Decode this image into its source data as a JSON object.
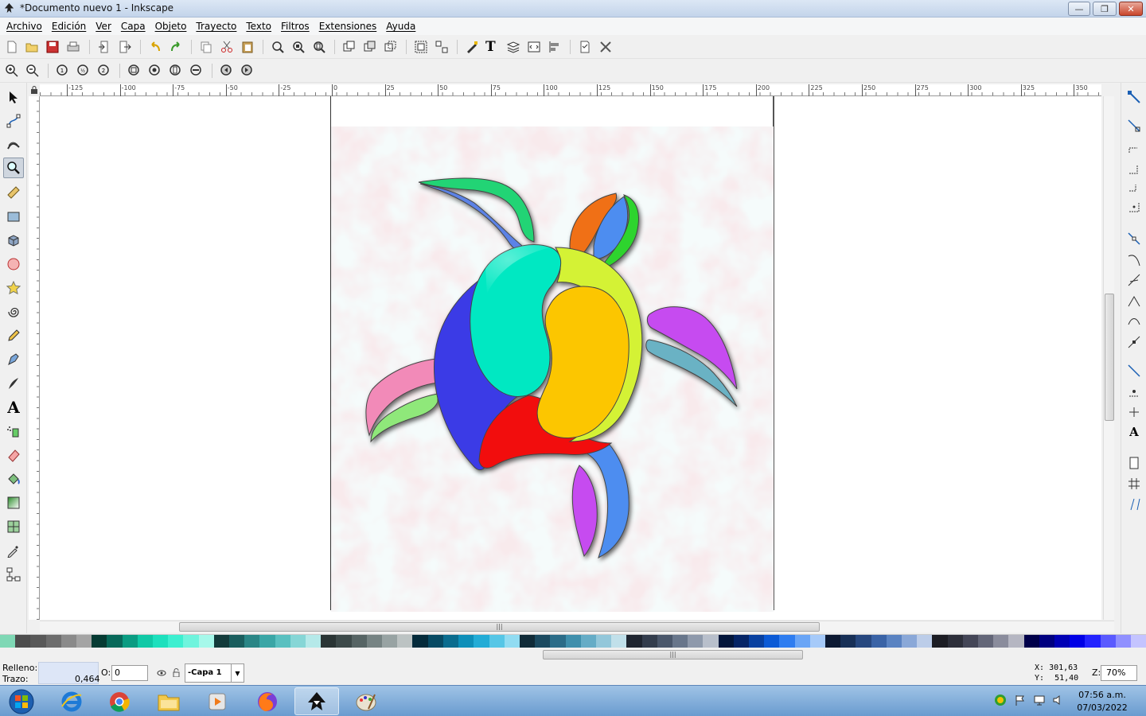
{
  "window": {
    "title": "*Documento nuevo 1 - Inkscape",
    "minimize": "—",
    "maximize": "❐",
    "close": "✕"
  },
  "menu": [
    "Archivo",
    "Edición",
    "Ver",
    "Capa",
    "Objeto",
    "Trayecto",
    "Texto",
    "Filtros",
    "Extensiones",
    "Ayuda"
  ],
  "ruler": {
    "labels": [
      "-125",
      "-100",
      "-75",
      "-50",
      "-25",
      "0",
      "25",
      "50",
      "75",
      "100",
      "125",
      "150",
      "175",
      "200",
      "225",
      "250",
      "275",
      "300",
      "325",
      "350"
    ]
  },
  "status": {
    "fill_label": "Relleno:",
    "stroke_label": "Trazo:",
    "stroke_width": "0,464",
    "opacity_label": "O:",
    "opacity_value": "0",
    "layer": "-Capa 1",
    "x_label": "X:",
    "x_value": "301,63",
    "y_label": "Y:",
    "y_value": "51,40",
    "zoom_label": "Z:",
    "zoom_value": "70%"
  },
  "taskbar": {
    "time": "07:56 a.m.",
    "date": "07/03/2022",
    "apps": [
      "start-button",
      "internet-explorer",
      "chrome",
      "file-explorer",
      "media-player",
      "firefox",
      "inkscape",
      "paint"
    ]
  },
  "palette": [
    "#7fd8b5",
    "#4d4d4d",
    "#595959",
    "#6d6d6d",
    "#8a8a8a",
    "#a4a4a4",
    "#063b33",
    "#08695a",
    "#0a9c82",
    "#10c9a6",
    "#1de0bd",
    "#3defd0",
    "#6ff4dd",
    "#a6f8ea",
    "#133b3b",
    "#1a5e5e",
    "#2a8686",
    "#3aa6a6",
    "#59c0c0",
    "#86d6d6",
    "#b5e9e9",
    "#2a3535",
    "#3d4a4a",
    "#566464",
    "#768383",
    "#98a3a3",
    "#bcc3c3",
    "#052b3b",
    "#074a63",
    "#0a6c8e",
    "#0e8fb9",
    "#23acd6",
    "#56c6e6",
    "#91dcf2",
    "#102b38",
    "#1b4a60",
    "#2b6c88",
    "#3f8fac",
    "#65acc6",
    "#93c7da",
    "#c1e0ea",
    "#1f2530",
    "#333d4d",
    "#4a576b",
    "#68768b",
    "#8e99ab",
    "#b8bfcb",
    "#03163b",
    "#052466",
    "#0840a0",
    "#0b5ad6",
    "#2f7df0",
    "#6aa5f6",
    "#a6caf9",
    "#0d1a33",
    "#183057",
    "#27487f",
    "#3a63a6",
    "#5a83c2",
    "#8aa8d8",
    "#bccde9",
    "#1c1d24",
    "#2d2f3a",
    "#444657",
    "#636678",
    "#8a8c9c",
    "#b5b6c2",
    "#00004a",
    "#000080",
    "#0000b5",
    "#0000e6",
    "#2323ff",
    "#5a5aff",
    "#9090ff",
    "#c4c4ff"
  ]
}
